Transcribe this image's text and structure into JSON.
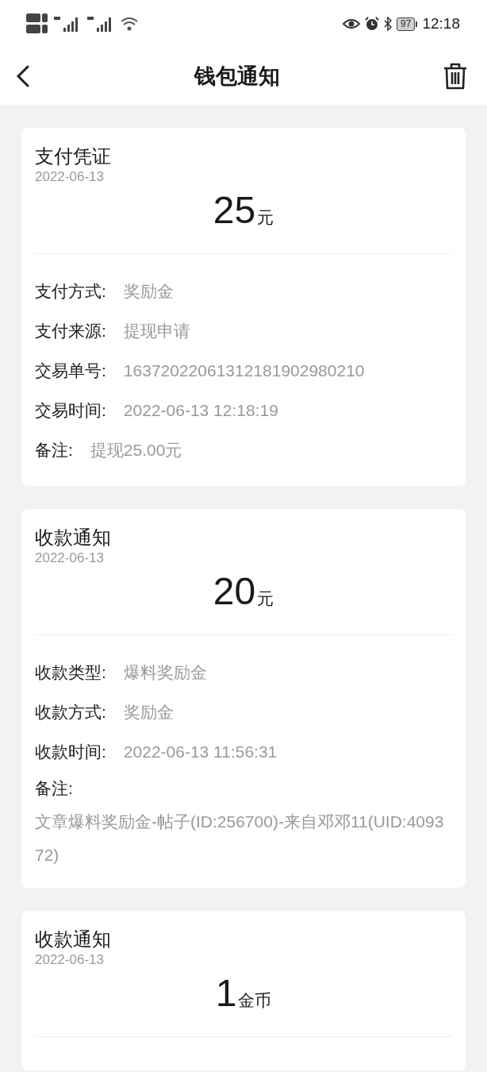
{
  "status_bar": {
    "time": "12:18",
    "battery": "97"
  },
  "header": {
    "title": "钱包通知"
  },
  "notifications": [
    {
      "title": "支付凭证",
      "date": "2022-06-13",
      "amount": "25",
      "unit": "元",
      "fields": [
        {
          "kind": "inline",
          "label": "支付方式:",
          "value": "奖励金"
        },
        {
          "kind": "inline",
          "label": "支付来源:",
          "value": "提现申请"
        },
        {
          "kind": "inline",
          "label": "交易单号:",
          "value": "16372022061312181902980210"
        },
        {
          "kind": "inline",
          "label": "交易时间:",
          "value": "2022-06-13 12:18:19"
        },
        {
          "kind": "inline",
          "label": "备注:",
          "value": "提现25.00元"
        }
      ]
    },
    {
      "title": "收款通知",
      "date": "2022-06-13",
      "amount": "20",
      "unit": "元",
      "fields": [
        {
          "kind": "inline",
          "label": "收款类型:",
          "value": "爆料奖励金"
        },
        {
          "kind": "inline",
          "label": "收款方式:",
          "value": "奖励金"
        },
        {
          "kind": "inline",
          "label": "收款时间:",
          "value": "2022-06-13 11:56:31"
        },
        {
          "kind": "block",
          "label": "备注:",
          "value": "文章爆料奖励金-帖子(ID:256700)-来自邓邓11(UID:409372)"
        }
      ]
    },
    {
      "title": "收款通知",
      "date": "2022-06-13",
      "amount": "1",
      "unit": "金币"
    }
  ]
}
